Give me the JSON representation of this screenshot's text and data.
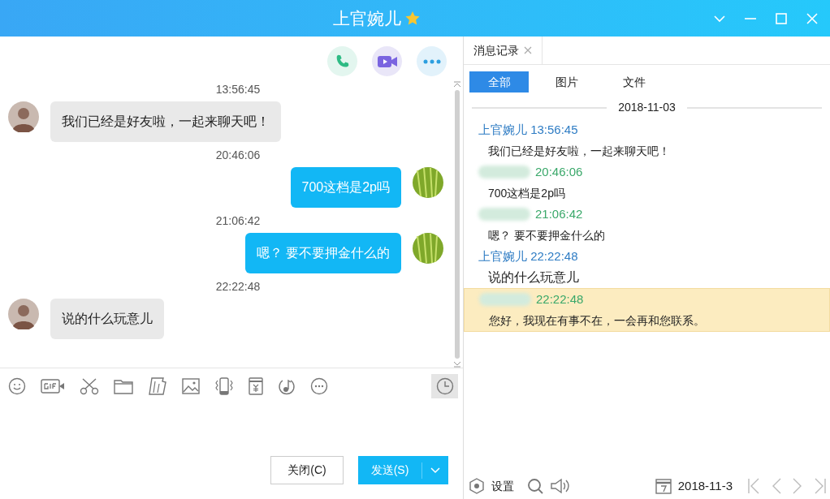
{
  "window": {
    "title": "上官婉儿"
  },
  "chat": {
    "messages": [
      {
        "time": "13:56:45",
        "kind": "received",
        "text": "我们已经是好友啦，一起来聊天吧！"
      },
      {
        "time": "20:46:06",
        "kind": "sent",
        "text": "700这档是2p吗"
      },
      {
        "time": "21:06:42",
        "kind": "sent",
        "text": "嗯？ 要不要押金什么的"
      },
      {
        "time": "22:22:48",
        "kind": "received",
        "text": "说的什么玩意儿"
      }
    ]
  },
  "buttons": {
    "close": "关闭(C)",
    "send": "发送(S)"
  },
  "history": {
    "tab": "消息记录",
    "filters": [
      {
        "label": "全部",
        "selected": true
      },
      {
        "label": "图片",
        "selected": false
      },
      {
        "label": "文件",
        "selected": false
      }
    ],
    "date": "2018-11-03",
    "entries": [
      {
        "kind": "peer",
        "name": "上官婉儿",
        "time": "13:56:45",
        "text": "我们已经是好友啦，一起来聊天吧！",
        "highlighted": false
      },
      {
        "kind": "self",
        "time": "20:46:06",
        "text": "700这档是2p吗",
        "highlighted": false
      },
      {
        "kind": "self",
        "time": "21:06:42",
        "text": "嗯？ 要不要押金什么的",
        "highlighted": false
      },
      {
        "kind": "peer",
        "name": "上官婉儿",
        "time": "22:22:48",
        "text": "说的什么玩意儿",
        "highlighted": false
      },
      {
        "kind": "self",
        "time": "22:22:48",
        "text": "您好，我现在有事不在，一会再和您联系。",
        "highlighted": true
      }
    ],
    "settings": "设置",
    "current_date": "2018-11-3"
  }
}
